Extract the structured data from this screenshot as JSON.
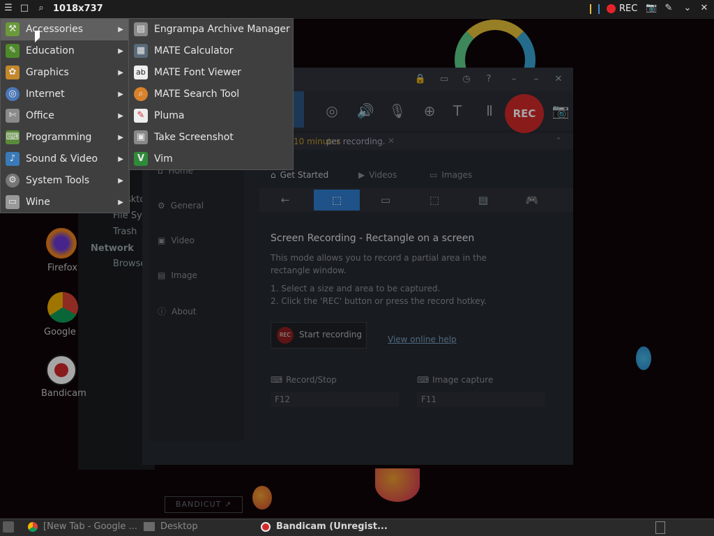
{
  "topbar": {
    "title": "1018x737",
    "rec_label": "REC"
  },
  "desktop": {
    "file_manager": {
      "items": [
        "Desktop",
        "File System",
        "Trash"
      ],
      "section": "Network",
      "network_item": "Browse Network"
    },
    "icons": [
      {
        "label": "Firefox"
      },
      {
        "label": "Google"
      },
      {
        "label": "Bandicam"
      }
    ]
  },
  "bandicam": {
    "toolbar": {
      "rec_label": "REC"
    },
    "notice": {
      "prefix": "10 minutes",
      "suffix": "per recording."
    },
    "sidebar": [
      "Home",
      "General",
      "Video",
      "Image",
      "About"
    ],
    "tabs": [
      "Get Started",
      "Videos",
      "Images"
    ],
    "heading": "Screen Recording - Rectangle on a screen",
    "description": "This mode allows you to record a partial area in the rectangle window.",
    "steps": [
      "1. Select a size and area to be captured.",
      "2. Click the 'REC' button or press the record hotkey."
    ],
    "start_button": {
      "badge": "REC",
      "label": "Start recording"
    },
    "help_link": "View online help",
    "hotkeys": {
      "record_label": "Record/Stop",
      "record_value": "F12",
      "image_label": "Image capture",
      "image_value": "F11"
    },
    "bandicut": "BANDICUT ↗"
  },
  "menu": {
    "categories": [
      {
        "label": "Accessories",
        "icon": "accessories-icon",
        "selected": true
      },
      {
        "label": "Education",
        "icon": "education-icon",
        "selected": false
      },
      {
        "label": "Graphics",
        "icon": "graphics-icon",
        "selected": false
      },
      {
        "label": "Internet",
        "icon": "internet-icon",
        "selected": false
      },
      {
        "label": "Office",
        "icon": "office-icon",
        "selected": false
      },
      {
        "label": "Programming",
        "icon": "programming-icon",
        "selected": false
      },
      {
        "label": "Sound & Video",
        "icon": "sound-video-icon",
        "selected": false
      },
      {
        "label": "System Tools",
        "icon": "system-tools-icon",
        "selected": false
      },
      {
        "label": "Wine",
        "icon": "wine-icon",
        "selected": false
      }
    ],
    "accessories": [
      {
        "label": "Engrampa Archive Manager",
        "icon": "archive-icon"
      },
      {
        "label": "MATE Calculator",
        "icon": "calculator-icon"
      },
      {
        "label": "MATE Font Viewer",
        "icon": "font-viewer-icon"
      },
      {
        "label": "MATE Search Tool",
        "icon": "search-tool-icon"
      },
      {
        "label": "Pluma",
        "icon": "text-editor-icon"
      },
      {
        "label": "Take Screenshot",
        "icon": "screenshot-icon"
      },
      {
        "label": "Vim",
        "icon": "vim-icon"
      }
    ]
  },
  "taskbar": {
    "items": [
      {
        "label": "[New Tab - Google ...",
        "active": false
      },
      {
        "label": "Desktop",
        "active": false
      },
      {
        "label": "Bandicam (Unregist...",
        "active": true
      }
    ]
  },
  "colors": {
    "rec_red": "#d42a2a",
    "accent_blue": "#2f7fd1",
    "menu_bg": "#3f3f3f",
    "menu_selected": "#5f5f5f"
  }
}
